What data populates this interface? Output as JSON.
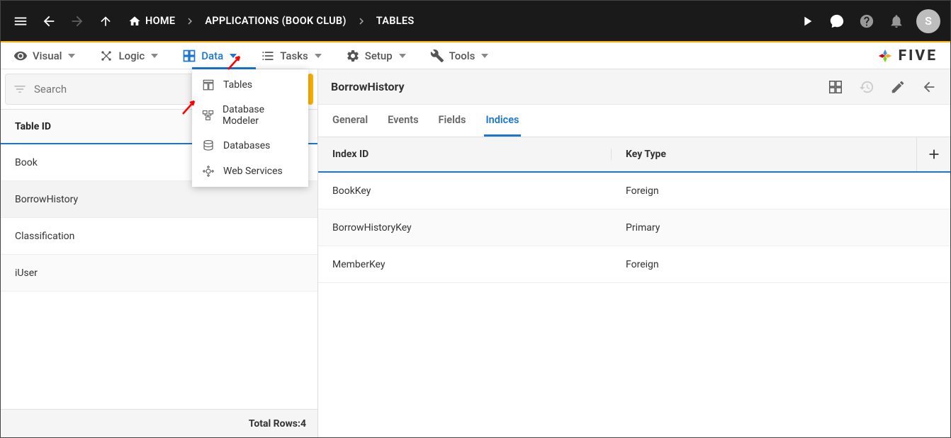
{
  "topbar": {
    "home_label": "HOME",
    "crumb_app": "APPLICATIONS (BOOK CLUB)",
    "crumb_page": "TABLES",
    "avatar_initial": "S"
  },
  "menubar": {
    "visual": "Visual",
    "logic": "Logic",
    "data": "Data",
    "tasks": "Tasks",
    "setup": "Setup",
    "tools": "Tools",
    "brand": "FIVE"
  },
  "dropdown": {
    "tables": "Tables",
    "modeler": "Database Modeler",
    "databases": "Databases",
    "webservices": "Web Services"
  },
  "left": {
    "search_placeholder": "Search",
    "header": "Table ID",
    "rows": [
      "Book",
      "BorrowHistory",
      "Classification",
      "iUser"
    ],
    "footer_label": "Total Rows: ",
    "footer_count": "4"
  },
  "detail": {
    "title": "BorrowHistory",
    "tabs": {
      "general": "General",
      "events": "Events",
      "fields": "Fields",
      "indices": "Indices"
    },
    "grid_header": {
      "c1": "Index ID",
      "c2": "Key Type"
    },
    "rows": [
      {
        "id": "BookKey",
        "type": "Foreign"
      },
      {
        "id": "BorrowHistoryKey",
        "type": "Primary"
      },
      {
        "id": "MemberKey",
        "type": "Foreign"
      }
    ]
  }
}
